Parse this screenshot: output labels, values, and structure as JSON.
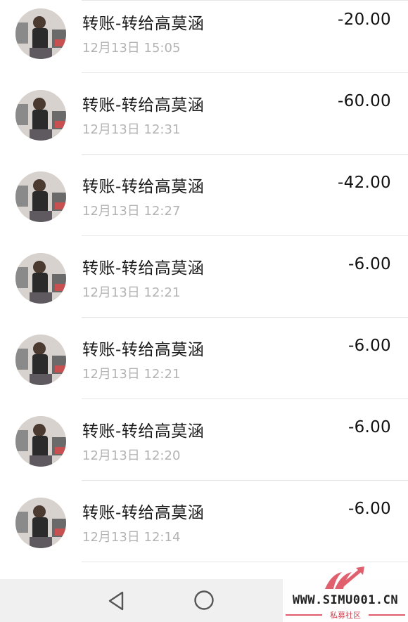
{
  "transactions": [
    {
      "title": "转账-转给高莫涵",
      "time": "12月13日 15:05",
      "amount": "-20.00"
    },
    {
      "title": "转账-转给高莫涵",
      "time": "12月13日 12:31",
      "amount": "-60.00"
    },
    {
      "title": "转账-转给高莫涵",
      "time": "12月13日 12:27",
      "amount": "-42.00"
    },
    {
      "title": "转账-转给高莫涵",
      "time": "12月13日 12:21",
      "amount": "-6.00"
    },
    {
      "title": "转账-转给高莫涵",
      "time": "12月13日 12:21",
      "amount": "-6.00"
    },
    {
      "title": "转账-转给高莫涵",
      "time": "12月13日 12:20",
      "amount": "-6.00"
    },
    {
      "title": "转账-转给高莫涵",
      "time": "12月13日 12:14",
      "amount": "-6.00"
    }
  ],
  "navbar": {
    "back_icon": "back-triangle-icon",
    "home_icon": "home-circle-icon"
  },
  "watermark": {
    "url": "WWW.SIMU001.CN",
    "subtitle": "私募社区",
    "accent_color": "#e05a6a"
  },
  "colors": {
    "title": "#1a1a1a",
    "time": "#b3b3b3",
    "amount": "#111111",
    "divider": "#e6e6e6",
    "navbar_bg": "#f0f0f0"
  }
}
